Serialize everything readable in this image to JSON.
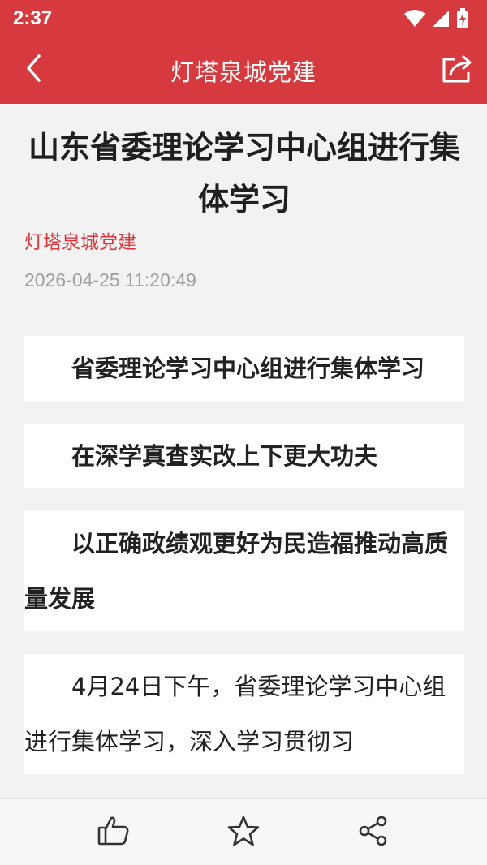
{
  "theme": {
    "accent": "#d63a3f"
  },
  "status_bar": {
    "time": "2:37",
    "icons": [
      "wifi-icon",
      "signal-icon",
      "battery-charging-icon"
    ]
  },
  "app_bar": {
    "title": "灯塔泉城党建",
    "back_icon": "back-arrow-icon",
    "share_icon": "share-out-icon"
  },
  "article": {
    "title": "山东省委理论学习中心组进行集体学习",
    "source": "灯塔泉城党建",
    "datetime": "2026-04-25 11:20:49",
    "headline_1": "省委理论学习中心组进行集体学习",
    "headline_2": "在深学真查实改上下更大功夫",
    "headline_3": "以正确政绩观更好为民造福推动高质量发展",
    "body_1": "4月24日下午，省委理论学习中心组进行集体学习，深入学习贯彻习"
  },
  "bottom_bar": {
    "actions": [
      "like-icon",
      "favorite-star-icon",
      "share-icon"
    ]
  }
}
